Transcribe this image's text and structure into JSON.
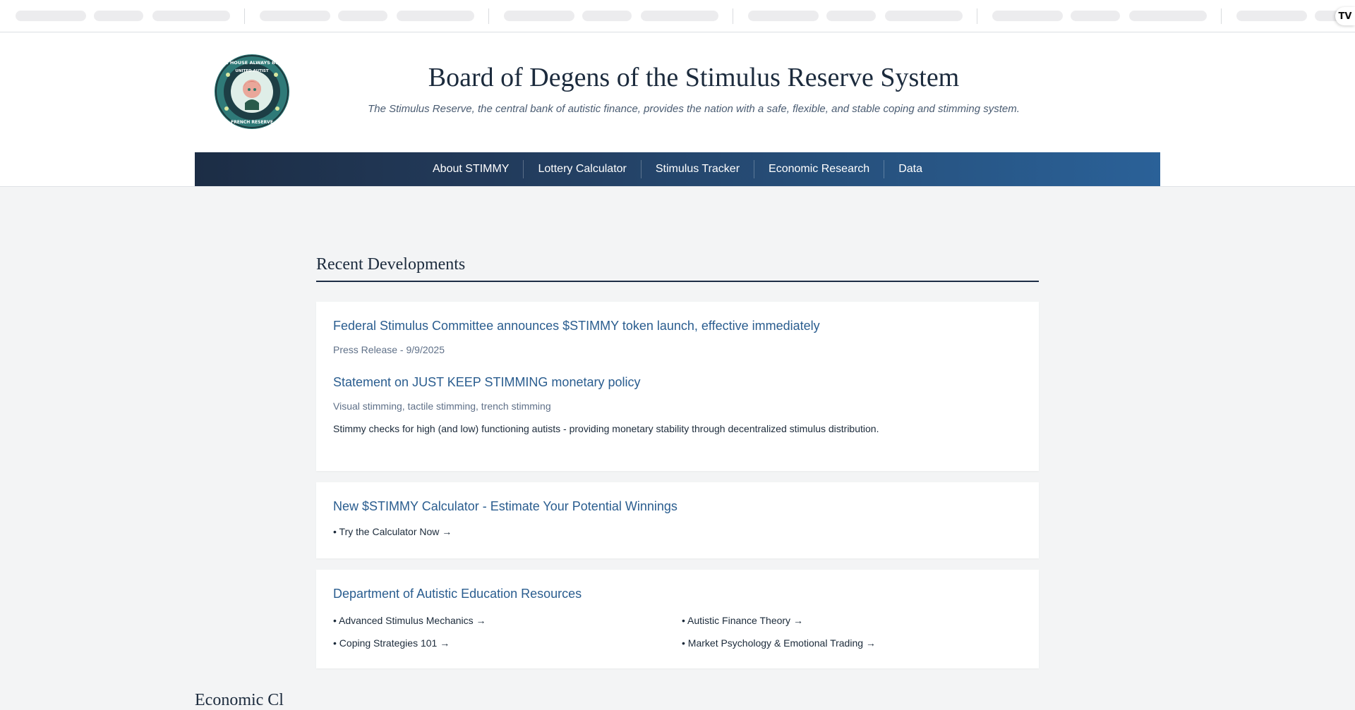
{
  "header": {
    "title": "Board of Degens of the Stimulus Reserve System",
    "tagline": "The Stimulus Reserve, the central bank of autistic finance, provides the nation with a safe, flexible, and stable coping and stimming system.",
    "seal": {
      "top_text": "THE HOUSE ALWAYS BUYS",
      "middle_text": "UNITED AUTIST",
      "bottom_text": "FRENCH RESERVE"
    }
  },
  "nav": {
    "items": [
      "About STIMMY",
      "Lottery Calculator",
      "Stimulus Tracker",
      "Economic Research",
      "Data"
    ]
  },
  "ticker": {
    "badge": "TV"
  },
  "main": {
    "section_title": "Recent Developments",
    "developments": {
      "items": [
        {
          "title": "Federal Stimulus Committee announces $STIMMY token launch, effective immediately",
          "meta": "Press Release - 9/9/2025"
        },
        {
          "title": "Statement on JUST KEEP STIMMING monetary policy",
          "meta": "Visual stimming, tactile stimming, trench stimming",
          "body": "Stimmy checks for high (and low) functioning autists - providing monetary stability through decentralized stimulus distribution."
        }
      ]
    },
    "calculator": {
      "title": "New $STIMMY Calculator - Estimate Your Potential Winnings",
      "link": "• Try the Calculator Now →"
    },
    "education": {
      "title": "Department of Autistic Education Resources",
      "links": [
        "• Advanced Stimulus Mechanics →",
        "• Autistic Finance Theory →",
        "• Coping Strategies 101 →",
        "• Market Psychology & Emotional Trading →"
      ]
    },
    "next_heading": "Economic Cl"
  },
  "colors": {
    "accent_link": "#2a5d8f",
    "nav_gradient_start": "#1c2d45",
    "nav_gradient_end": "#2a6198",
    "page_bg": "#f3f4f5"
  }
}
